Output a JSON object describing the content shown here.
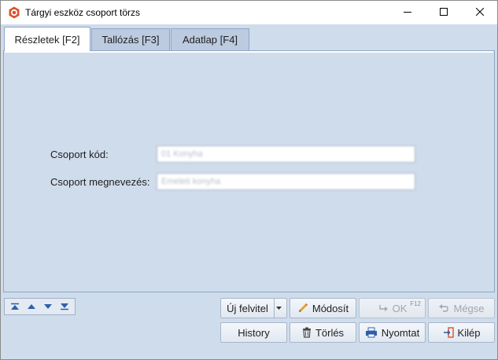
{
  "window": {
    "title": "Tárgyi eszköz csoport törzs",
    "controls": {
      "minimize": "minimize-icon",
      "maximize": "maximize-icon",
      "close": "close-icon"
    }
  },
  "tabs": [
    {
      "label": "Részletek [F2]",
      "active": true
    },
    {
      "label": "Tallózás [F3]",
      "active": false
    },
    {
      "label": "Adatlap [F4]",
      "active": false
    }
  ],
  "form": {
    "code_label": "Csoport kód:",
    "code_value": "01 Konyha",
    "name_label": "Csoport megnevezés:",
    "name_value": "Emeleti konyha"
  },
  "navigation": {
    "icons": [
      "first-record-icon",
      "previous-record-icon",
      "next-record-icon",
      "last-record-icon"
    ]
  },
  "buttons": {
    "new_record": "Új felvitel",
    "modify": "Módosít",
    "ok": "OK",
    "ok_shortcut": "F12",
    "cancel": "Mégse",
    "history": "History",
    "delete": "Törlés",
    "print": "Nyomtat",
    "exit": "Kilép"
  },
  "colors": {
    "background": "#cfdcec",
    "accent": "#d9532b"
  }
}
